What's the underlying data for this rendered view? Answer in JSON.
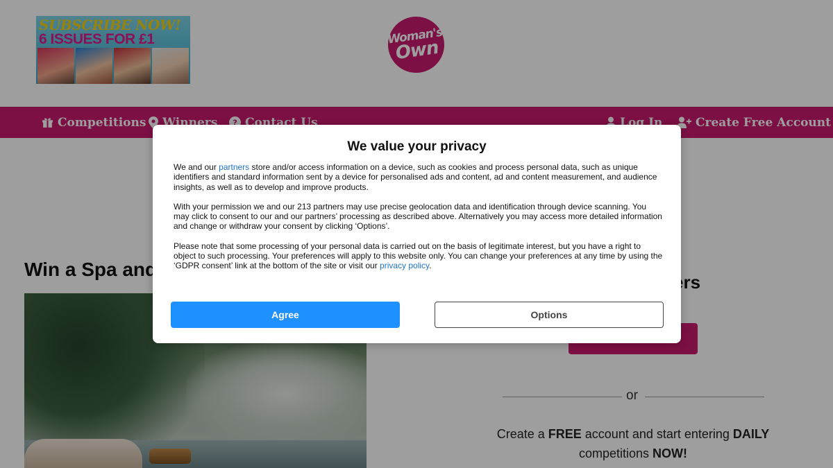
{
  "header": {
    "promo": {
      "line1": "SUBSCRIBE NOW!",
      "line2": "6 ISSUES FOR £1"
    },
    "logo": {
      "line1": "Woman's",
      "line2": "Own",
      "color": "#c8196f"
    }
  },
  "nav": {
    "color": "#c8196f",
    "items": [
      {
        "label": "Competitions",
        "icon": "gift-icon"
      },
      {
        "label": "Winners",
        "icon": "map-marker-icon"
      },
      {
        "label": "Contact Us",
        "icon": "question-circle-icon"
      },
      {
        "label": "Log In",
        "icon": "user-icon"
      },
      {
        "label": "Create Free Account",
        "icon": "user-plus-icon"
      }
    ]
  },
  "main": {
    "title": "Win a Spa and",
    "login_heading": "ers",
    "login_button_label": "",
    "or_label": "or",
    "promo_parts": [
      "Create a ",
      "FREE",
      " account and start entering ",
      "DAILY",
      " competitions ",
      "NOW!"
    ]
  },
  "modal": {
    "title": "We value your privacy",
    "para1_a": "We and our ",
    "para1_link": "partners",
    "para1_b": " store and/or access information on a device, such as cookies and process personal data, such as unique identifiers and standard information sent by a device for personalised ads and content, ad and content measurement, and audience insights, as well as to develop and improve products.",
    "para2": "With your permission we and our 213 partners may use precise geolocation data and identification through device scanning. You may click to consent to our and our partners’ processing as described above. Alternatively you may access more detailed information and change or withdraw your consent by clicking ‘Options’.",
    "para3_a": "Please note that some processing of your personal data is carried out on the basis of legitimate interest, but you have a right to object to such processing. Your preferences will apply to this website only. You can change your preferences at any time by using the ‘GDPR consent’ link at the bottom of the site or visit our ",
    "para3_link": "privacy policy",
    "para3_b": ".",
    "agree_label": "Agree",
    "options_label": "Options",
    "agree_color": "#1e90ff"
  }
}
